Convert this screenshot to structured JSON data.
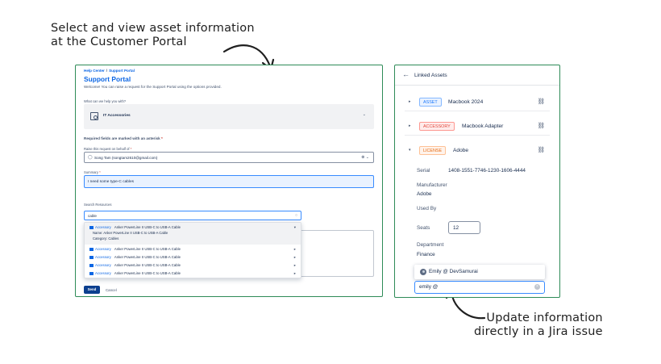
{
  "captions": {
    "top_line1": "Select and view asset information",
    "top_line2": "at the Customer Portal",
    "bottom_line1": "Update information",
    "bottom_line2": "directly in a Jira issue"
  },
  "portal": {
    "breadcrumb": [
      "Help Center",
      "Support Portal"
    ],
    "title": "Support Portal",
    "welcome": "Welcome! You can raise a request for the Support Portal using the options provided.",
    "help_question": "What can we help you with?",
    "request_type": "IT Accessories",
    "required_note": "Required fields are marked with an asterisk",
    "on_behalf_label": "Raise this request on behalf of",
    "on_behalf_value": "Song Tam (songtam2610@gmail.com)",
    "summary_label": "Summary",
    "summary_value": "I need some type-C cables",
    "search_label": "Search Resources",
    "search_value": "cable",
    "results": [
      {
        "category": "Accessory",
        "name": "Anker PowerLine II USB-C to USB-A Cable"
      },
      {
        "category": "Accessory",
        "name": "Anker PowerLine II USB-C to USB-A Cable"
      },
      {
        "category": "Accessory",
        "name": "Anker PowerLine II USB-C to USB-A Cable"
      },
      {
        "category": "Accessory",
        "name": "Anker PowerLine II USB-C to USB-A Cable"
      },
      {
        "category": "Accessory",
        "name": "Anker PowerLine II USB-C to USB-A Cable"
      },
      {
        "category": "Accessory",
        "name": "Anker PowerLine II USB-C to USB-A Cable"
      }
    ],
    "expanded_name_label": "Name:",
    "expanded_name_value": "Anker PowerLine II USB-C to USB-A Cable",
    "expanded_category_label": "Category:",
    "expanded_category_value": "Cables",
    "send_label": "Send",
    "cancel_label": "Cancel"
  },
  "linked_assets": {
    "title": "Linked Assets",
    "rows": [
      {
        "type": "ASSET",
        "name": "Macbook 2024",
        "color": "#1d7afc"
      },
      {
        "type": "ACCESSORY",
        "name": "Macbook Adapter",
        "color": "#e2483d"
      },
      {
        "type": "LICENSE",
        "name": "Adobe",
        "color": "#e56910"
      }
    ],
    "details": {
      "serial_label": "Serial",
      "serial_value": "1408-1551-7746-1230-1606-4444",
      "manufacturer_label": "Manufacturer",
      "manufacturer_value": "Adobe",
      "used_by_label": "Used By",
      "seats_label": "Seats",
      "seats_value": "12",
      "department_label": "Department",
      "department_value": "Finance"
    },
    "user_suggestion": "Emily @ DevSamurai",
    "mention_input": "emily @"
  },
  "colors": {
    "panel_border": "#2e8b57",
    "accent": "#0c66e4",
    "send_button": "#0c3f8f"
  },
  "icons": [
    "arrow-icon",
    "back-arrow-icon",
    "unlink-icon",
    "chevron-down-icon",
    "chevron-right-icon",
    "user-icon",
    "clear-icon",
    "computer-icon"
  ]
}
